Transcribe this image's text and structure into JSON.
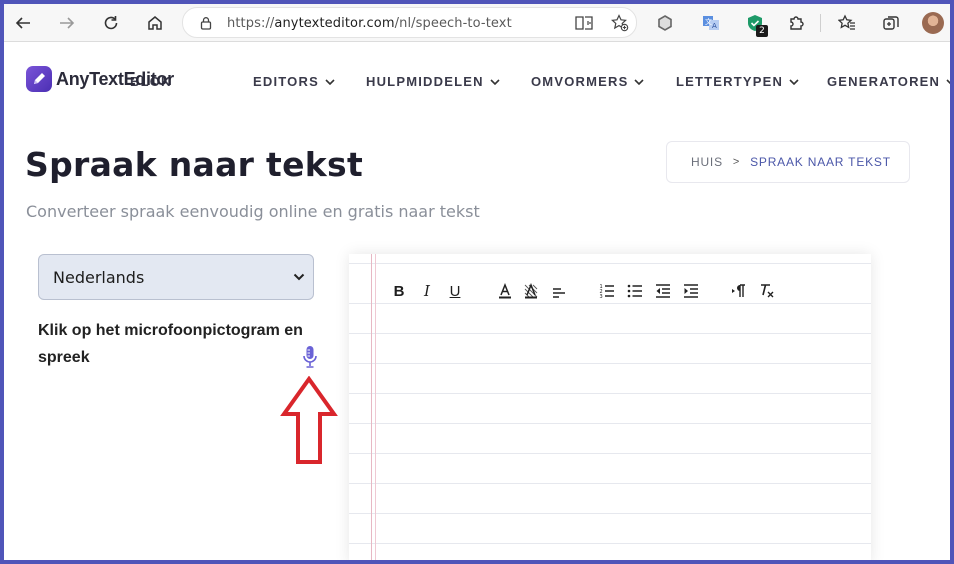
{
  "browser": {
    "url_prefix": "https://",
    "url_host": "anytexteditor.com",
    "url_path": "/nl/speech-to-text",
    "extension_badge": "2"
  },
  "site": {
    "brand": "AnyTextEditor",
    "hidden_nav": "BLOK",
    "nav": [
      {
        "label": "EDITORS"
      },
      {
        "label": "HULPMIDDELEN"
      },
      {
        "label": "OMVORMERS"
      },
      {
        "label": "LETTERTYPEN"
      },
      {
        "label": "GENERATOREN"
      }
    ]
  },
  "page": {
    "title": "Spraak naar tekst",
    "subtitle": "Converteer spraak eenvoudig online en gratis naar tekst",
    "breadcrumb": {
      "home": "HUIS",
      "sep": ">",
      "current": "SPRAAK NAAR TEKST"
    },
    "language": "Nederlands",
    "instruction": "Klik op het microfoonpictogram en spreek"
  },
  "editor": {
    "tools": [
      "bold-tool",
      "italic-tool",
      "underline-tool",
      "font-color-tool",
      "highlight-tool",
      "align-tool",
      "ordered-list-tool",
      "bullet-list-tool",
      "outdent-tool",
      "indent-tool",
      "text-direction-tool",
      "clear-format-tool"
    ],
    "bold": "B",
    "italic": "I",
    "underline": "U"
  },
  "colors": {
    "frame": "#5055b9",
    "accent": "#6c4fd4",
    "arrow": "#d9262c",
    "mic": "#6a62d6"
  }
}
